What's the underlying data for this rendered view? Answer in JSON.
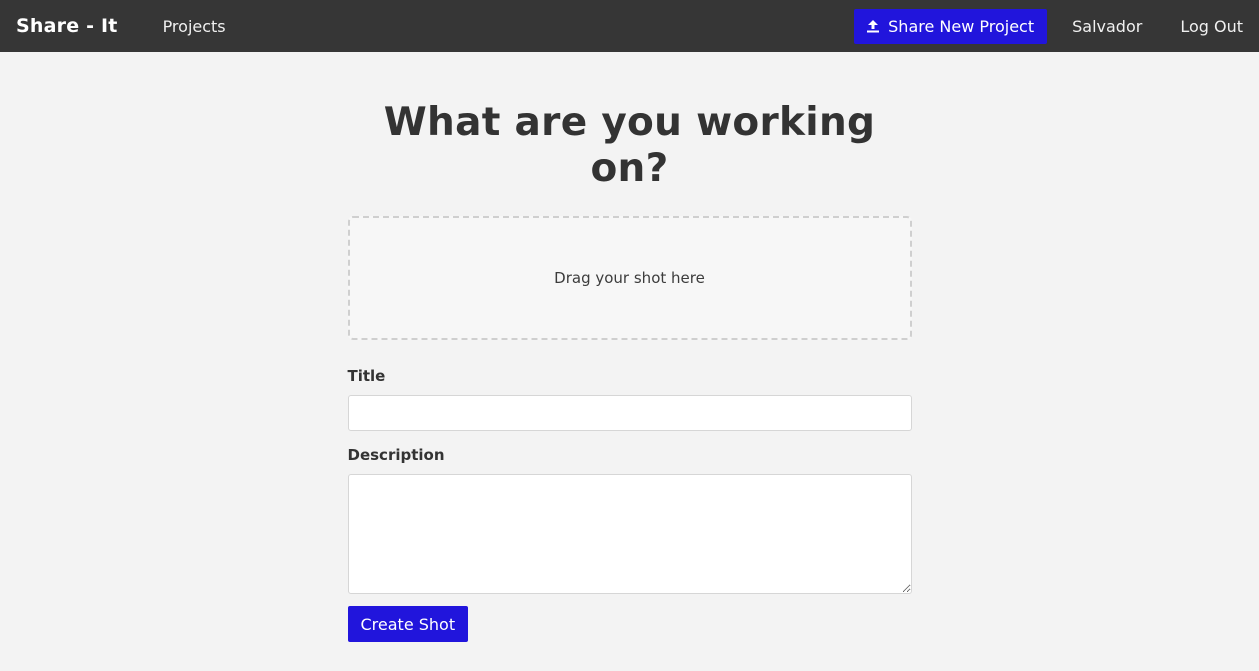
{
  "navbar": {
    "brand": "Share - It",
    "projects_label": "Projects",
    "share_button_label": "Share New Project",
    "share_icon": "upload-icon",
    "user_name": "Salvador",
    "logout_label": "Log Out"
  },
  "main": {
    "title": "What are you working on?",
    "dropzone_text": "Drag your shot here",
    "title_label": "Title",
    "title_value": "",
    "description_label": "Description",
    "description_value": "",
    "submit_label": "Create Shot"
  },
  "colors": {
    "navbar_bg": "#363636",
    "accent": "#2115dc",
    "page_bg": "#f3f3f3"
  }
}
